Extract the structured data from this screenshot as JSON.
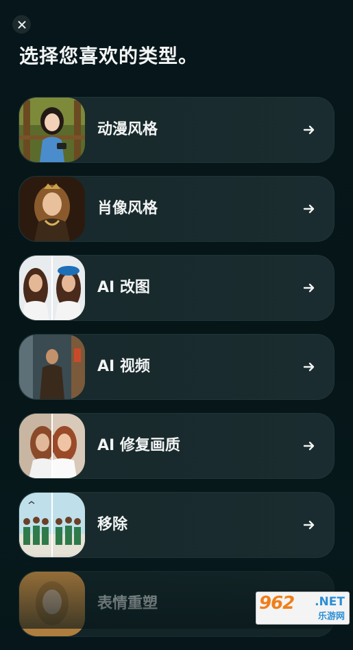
{
  "header": {
    "close_icon": "close-icon",
    "title": "选择您喜欢的类型。"
  },
  "options": [
    {
      "label": "动漫风格",
      "thumb": "anime-girl-thumbnail",
      "icon": "arrow-right-icon"
    },
    {
      "label": "肖像风格",
      "thumb": "portrait-thumbnail",
      "icon": "arrow-right-icon"
    },
    {
      "label": "AI 改图",
      "thumb": "ai-edit-thumbnail",
      "icon": "arrow-right-icon"
    },
    {
      "label": "AI 视频",
      "thumb": "ai-video-thumbnail",
      "icon": "arrow-right-icon"
    },
    {
      "label": "AI 修复画质",
      "thumb": "ai-restore-thumbnail",
      "icon": "arrow-right-icon"
    },
    {
      "label": "移除",
      "thumb": "remove-thumbnail",
      "icon": "arrow-right-icon"
    },
    {
      "label": "表情重塑",
      "thumb": "expression-thumbnail",
      "icon": "arrow-right-icon"
    }
  ],
  "watermark": {
    "brand": "962",
    "domain": ".NET",
    "subtitle": "乐游网"
  },
  "colors": {
    "background": "#06161a",
    "card": "#18292c",
    "text": "#f2f4f4"
  }
}
